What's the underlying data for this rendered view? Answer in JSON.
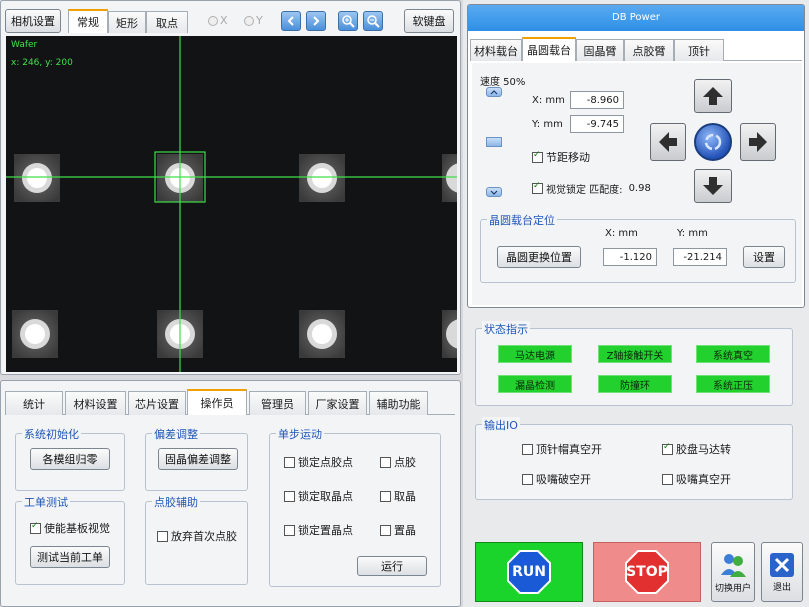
{
  "camera": {
    "settings_btn": "相机设置",
    "tabs": [
      "常规",
      "矩形",
      "取点"
    ],
    "radio_x": "X",
    "radio_y": "Y",
    "keyboard_btn": "软键盘",
    "overlay_title": "Wafer",
    "overlay_coords": "x: 246, y: 200"
  },
  "bottom_tabs": [
    "统计",
    "材料设置",
    "芯片设置",
    "操作员",
    "管理员",
    "厂家设置",
    "辅助功能"
  ],
  "operator": {
    "sys_init": {
      "title": "系统初始化",
      "button": "各模组归零"
    },
    "offset": {
      "title": "偏差调整",
      "button": "固晶偏差调整"
    },
    "single_step": {
      "title": "单步运动",
      "left": [
        "锁定点胶点",
        "锁定取晶点",
        "锁定置晶点"
      ],
      "right": [
        "点胶",
        "取晶",
        "置晶"
      ],
      "run": "运行"
    },
    "work_test": {
      "title": "工单测试",
      "checkbox": "使能基板视觉",
      "button": "测试当前工单"
    },
    "dispense_aux": {
      "title": "点胶辅助",
      "checkbox": "放弃首次点胶"
    }
  },
  "db": {
    "title": "DB Power",
    "tabs": [
      "材料载台",
      "晶圆载台",
      "固晶臂",
      "点胶臂",
      "顶针"
    ],
    "speed_label": "速度 50%",
    "x_label": "X: mm",
    "x_value": "-8.960",
    "y_label": "Y: mm",
    "y_value": "-9.745",
    "pitch_move": "节距移动",
    "vision_lock": "视觉锁定 匹配度:",
    "match_value": "0.98",
    "wafer_pos": {
      "title": "晶圆载台定位",
      "x_label": "X: mm",
      "y_label": "Y: mm",
      "change_btn": "晶圆更换位置",
      "x_value": "-1.120",
      "y_value": "-21.214",
      "set_btn": "设置"
    }
  },
  "status": {
    "title": "状态指示",
    "items": [
      "马达电源",
      "Z轴接触开关",
      "系统真空",
      "漏晶检测",
      "防撞环",
      "系统正压"
    ]
  },
  "io": {
    "title": "输出IO",
    "items": [
      {
        "label": "顶针帽真空开",
        "checked": false
      },
      {
        "label": "胶盘马达转",
        "checked": true
      },
      {
        "label": "吸嘴破空开",
        "checked": false
      },
      {
        "label": "吸嘴真空开",
        "checked": false
      }
    ]
  },
  "actions": {
    "run": "RUN",
    "stop": "STOP",
    "switch_user": "切换用户",
    "exit": "退出"
  },
  "colors": {
    "accent_blue": "#1f57b8",
    "status_green": "#22d12e",
    "run_green": "#1bd42b",
    "stop_red": "#f08b8b",
    "title_bar": "#2e8fe6"
  }
}
